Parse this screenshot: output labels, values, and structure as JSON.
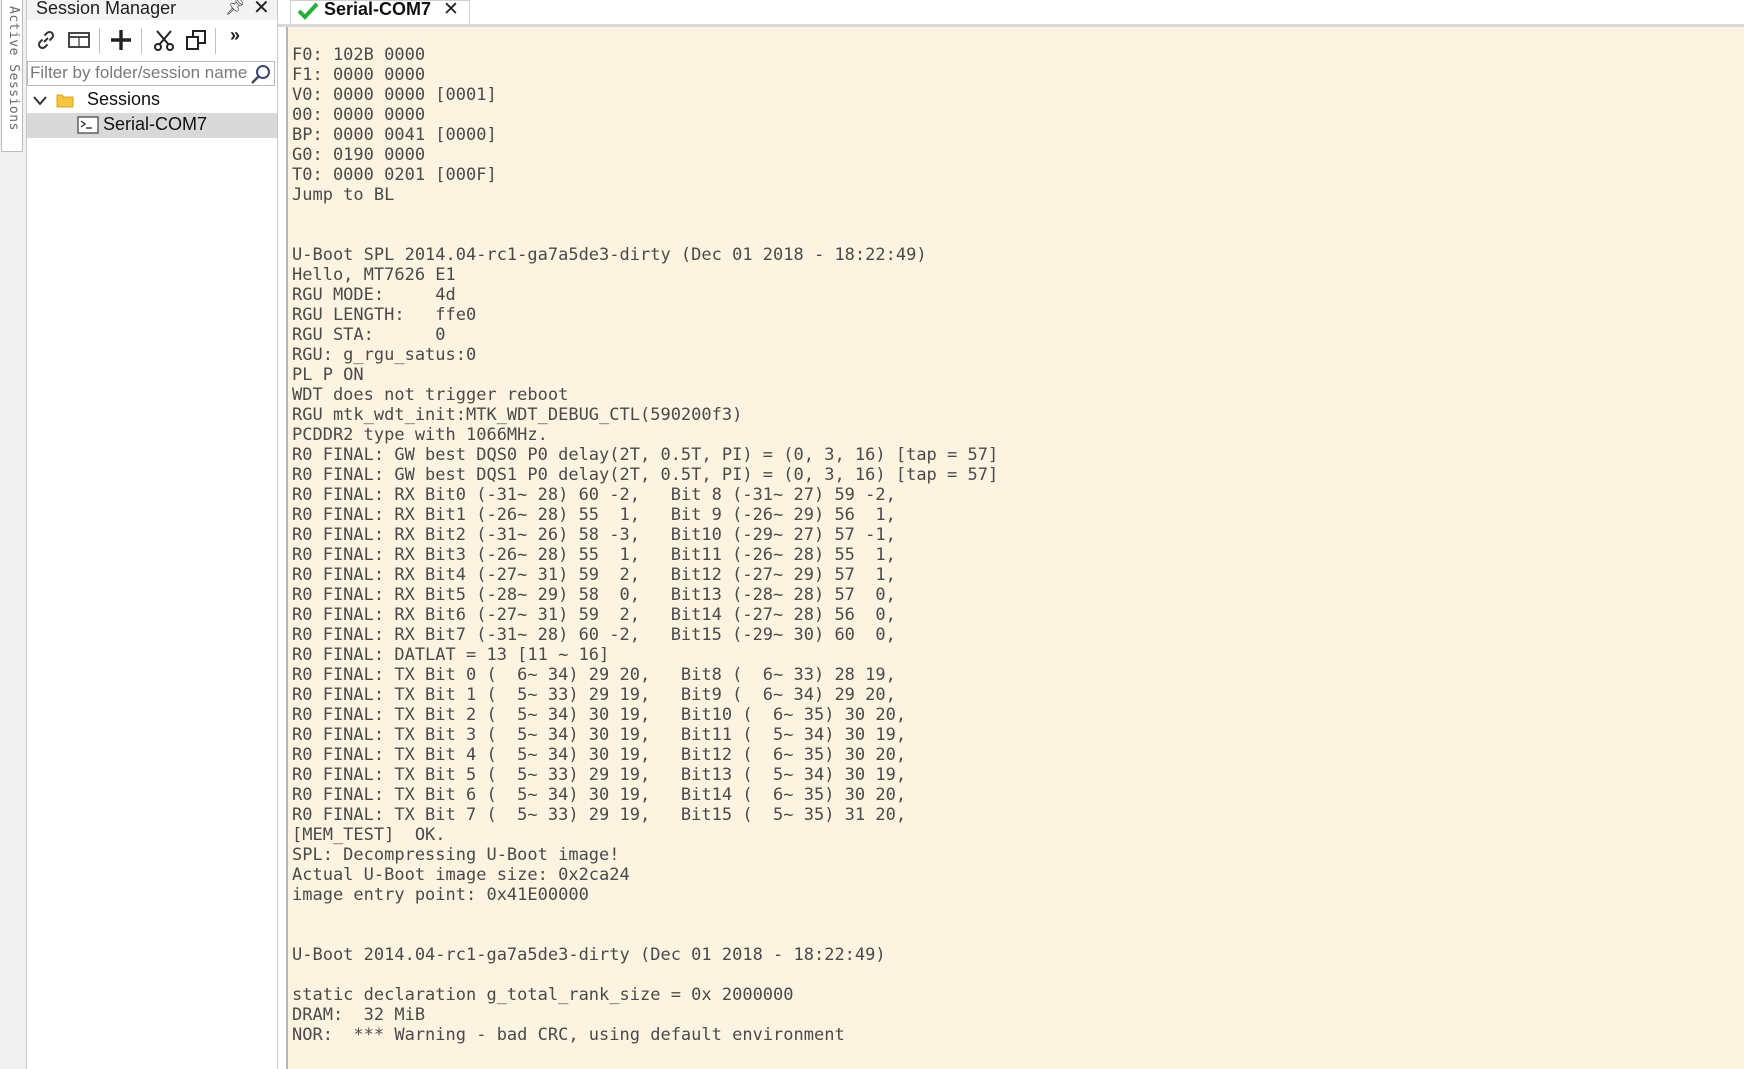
{
  "side_strip": {
    "label": "Active Sessions"
  },
  "session_manager": {
    "title": "Session Manager",
    "filter_placeholder": "Filter by folder/session name",
    "tree": {
      "folder": "Sessions",
      "session": "Serial-COM7"
    }
  },
  "tabs": [
    {
      "label": "Serial-COM7",
      "status": "connected"
    }
  ],
  "icons": {
    "toolbar": [
      "link-icon",
      "window-icon",
      "add-icon",
      "cut-icon",
      "copy-icon",
      "more-icon"
    ]
  },
  "colors": {
    "terminal_bg": "#fcf4e1",
    "terminal_fg": "#4a4a4a",
    "connected_check": "#27ae3b",
    "folder": "#f5c542"
  },
  "terminal": {
    "lines": [
      "F0: 102B 0000",
      "F1: 0000 0000",
      "V0: 0000 0000 [0001]",
      "00: 0000 0000",
      "BP: 0000 0041 [0000]",
      "G0: 0190 0000",
      "T0: 0000 0201 [000F]",
      "Jump to BL",
      "",
      "",
      "U-Boot SPL 2014.04-rc1-ga7a5de3-dirty (Dec 01 2018 - 18:22:49)",
      "Hello, MT7626 E1",
      "RGU MODE:     4d",
      "RGU LENGTH:   ffe0",
      "RGU STA:      0",
      "RGU: g_rgu_satus:0",
      "PL P ON",
      "WDT does not trigger reboot",
      "RGU mtk_wdt_init:MTK_WDT_DEBUG_CTL(590200f3)",
      "PCDDR2 type with 1066MHz.",
      "R0 FINAL: GW best DQS0 P0 delay(2T, 0.5T, PI) = (0, 3, 16) [tap = 57]",
      "R0 FINAL: GW best DQS1 P0 delay(2T, 0.5T, PI) = (0, 3, 16) [tap = 57]",
      "R0 FINAL: RX Bit0 (-31~ 28) 60 -2,   Bit 8 (-31~ 27) 59 -2,",
      "R0 FINAL: RX Bit1 (-26~ 28) 55  1,   Bit 9 (-26~ 29) 56  1,",
      "R0 FINAL: RX Bit2 (-31~ 26) 58 -3,   Bit10 (-29~ 27) 57 -1,",
      "R0 FINAL: RX Bit3 (-26~ 28) 55  1,   Bit11 (-26~ 28) 55  1,",
      "R0 FINAL: RX Bit4 (-27~ 31) 59  2,   Bit12 (-27~ 29) 57  1,",
      "R0 FINAL: RX Bit5 (-28~ 29) 58  0,   Bit13 (-28~ 28) 57  0,",
      "R0 FINAL: RX Bit6 (-27~ 31) 59  2,   Bit14 (-27~ 28) 56  0,",
      "R0 FINAL: RX Bit7 (-31~ 28) 60 -2,   Bit15 (-29~ 30) 60  0,",
      "R0 FINAL: DATLAT = 13 [11 ~ 16]",
      "R0 FINAL: TX Bit 0 (  6~ 34) 29 20,   Bit8 (  6~ 33) 28 19,",
      "R0 FINAL: TX Bit 1 (  5~ 33) 29 19,   Bit9 (  6~ 34) 29 20,",
      "R0 FINAL: TX Bit 2 (  5~ 34) 30 19,   Bit10 (  6~ 35) 30 20,",
      "R0 FINAL: TX Bit 3 (  5~ 34) 30 19,   Bit11 (  5~ 34) 30 19,",
      "R0 FINAL: TX Bit 4 (  5~ 34) 30 19,   Bit12 (  6~ 35) 30 20,",
      "R0 FINAL: TX Bit 5 (  5~ 33) 29 19,   Bit13 (  5~ 34) 30 19,",
      "R0 FINAL: TX Bit 6 (  5~ 34) 30 19,   Bit14 (  6~ 35) 30 20,",
      "R0 FINAL: TX Bit 7 (  5~ 33) 29 19,   Bit15 (  5~ 35) 31 20,",
      "[MEM_TEST]  OK.",
      "SPL: Decompressing U-Boot image!",
      "Actual U-Boot image size: 0x2ca24",
      "image entry point: 0x41E00000",
      "",
      "",
      "U-Boot 2014.04-rc1-ga7a5de3-dirty (Dec 01 2018 - 18:22:49)",
      "",
      "static declaration g_total_rank_size = 0x 2000000",
      "DRAM:  32 MiB",
      "NOR:  *** Warning - bad CRC, using default environment"
    ]
  }
}
